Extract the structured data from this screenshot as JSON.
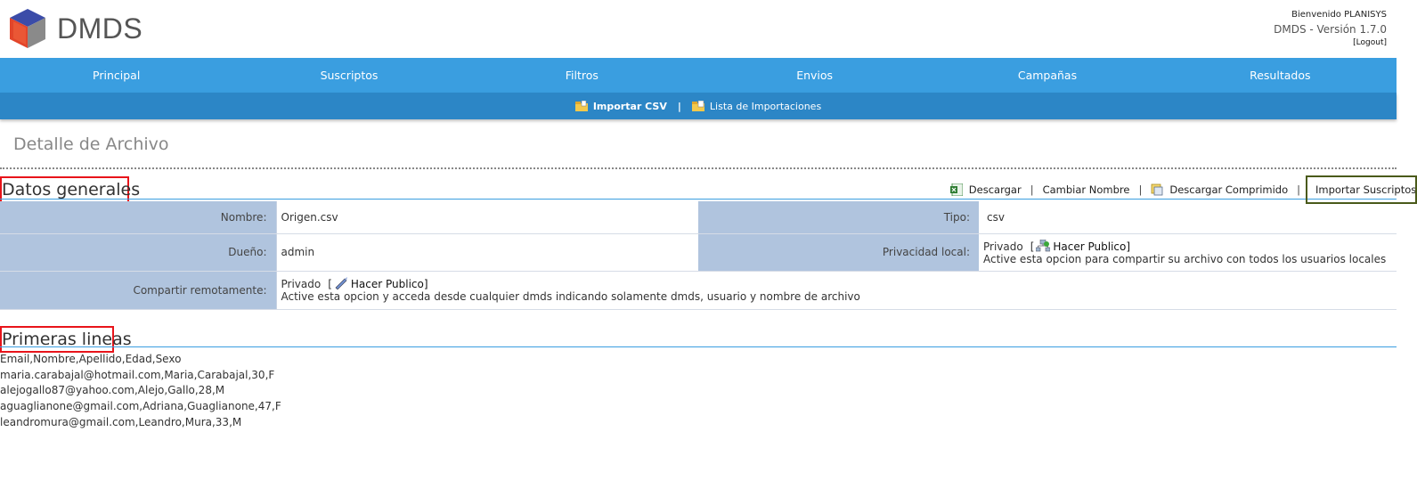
{
  "header": {
    "app_name": "DMDS",
    "welcome": "Bienvenido PLANISYS",
    "version": "DMDS - Versión 1.7.0",
    "logout": "[Logout]"
  },
  "nav": {
    "items": [
      "Principal",
      "Suscriptos",
      "Filtros",
      "Envios",
      "Campañas",
      "Resultados"
    ]
  },
  "subnav": {
    "import_csv": "Importar CSV",
    "separator": "|",
    "import_list": "Lista de Importaciones"
  },
  "page": {
    "title": "Detalle de Archivo"
  },
  "general": {
    "title": "Datos generales",
    "actions": {
      "download": "Descargar",
      "rename": "Cambiar Nombre",
      "download_compressed": "Descargar Comprimido",
      "import_subscribers": "Importar Suscriptos",
      "separator": "|"
    },
    "fields": {
      "name_label": "Nombre:",
      "name_value": "Origen.csv",
      "type_label": "Tipo:",
      "type_value": "csv",
      "owner_label": "Dueño:",
      "owner_value": "admin",
      "local_privacy_label": "Privacidad local:",
      "local_privacy_value": "Privado",
      "local_make_public": "Hacer Publico]",
      "local_bracket": "[",
      "local_desc": "Active esta opcion para compartir su archivo con todos los usuarios locales",
      "remote_label": "Compartir remotamente:",
      "remote_value": "Privado",
      "remote_bracket": "[",
      "remote_make_public": "Hacer Publico]",
      "remote_desc": "Active esta opcion y acceda desde cualquier dmds indicando solamente dmds, usuario y nombre de archivo"
    }
  },
  "first_lines": {
    "title": "Primeras lineas",
    "lines": [
      "Email,Nombre,Apellido,Edad,Sexo",
      "maria.carabajal@hotmail.com,Maria,Carabajal,30,F",
      "alejogallo87@yahoo.com,Alejo,Gallo,28,M",
      "aguaglianone@gmail.com,Adriana,Guaglianone,47,F",
      "leandromura@gmail.com,Leandro,Mura,33,M"
    ]
  },
  "colors": {
    "nav_blue": "#3a9ee0",
    "subnav_blue": "#2c86c6",
    "label_bg": "#b0c4de",
    "highlight_red": "#e8141a"
  }
}
